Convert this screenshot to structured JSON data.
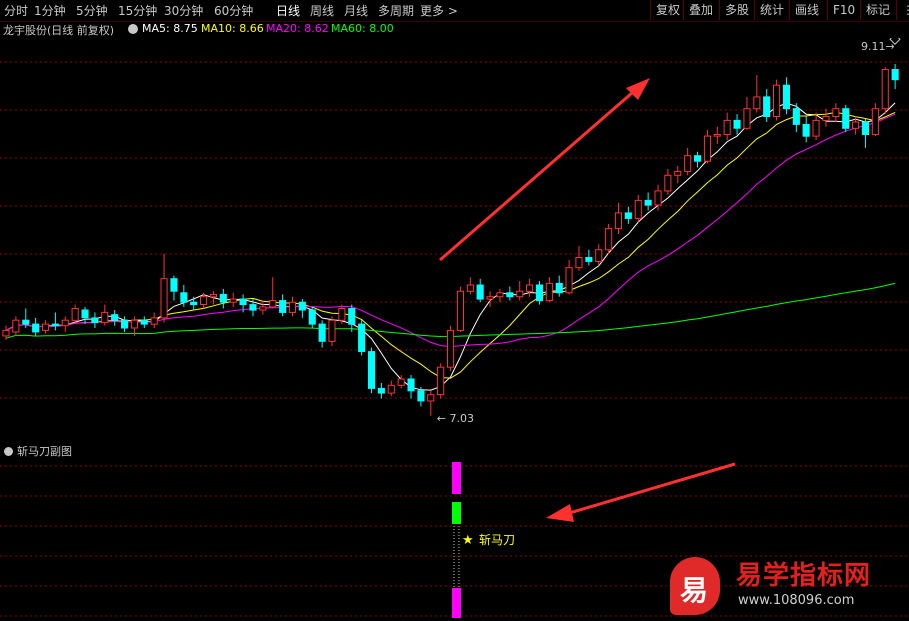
{
  "toolbar": {
    "tabs": [
      "分时",
      "1分钟",
      "5分钟",
      "15分钟",
      "30分钟",
      "60分钟",
      "日线",
      "周线",
      "月线",
      "多周期",
      "更多 >"
    ],
    "active_tab": "日线",
    "right_buttons": [
      "复权",
      "叠加",
      "多股",
      "统计",
      "画线",
      "F10",
      "标记"
    ],
    "more_icon": "ellipsis-icon"
  },
  "header": {
    "stock_title": "龙宇股份(日线 前复权)",
    "ma": [
      {
        "label": "MA5: 8.75",
        "color": "#ffffff"
      },
      {
        "label": "MA10: 8.66",
        "color": "#ffff00"
      },
      {
        "label": "MA20: 8.62",
        "color": "#ff00ff"
      },
      {
        "label": "MA60: 8.00",
        "color": "#00ff00"
      }
    ]
  },
  "main_chart": {
    "price_high_label": "9.11",
    "price_low_label": "7.03",
    "colors": {
      "up": "#ff3232",
      "down": "#00ffff",
      "ma5": "#ffffff",
      "ma10": "#ffff00",
      "ma20": "#ff00ff",
      "ma60": "#00ff00",
      "grid": "#8b0000",
      "arrow": "#ff3030"
    }
  },
  "sub_chart": {
    "title": "斩马刀副图",
    "signal_label": "斩马刀",
    "star": "★",
    "colors": {
      "pink": "#ff00ff",
      "green": "#00ff00",
      "label": "#ffff00"
    }
  },
  "watermark": {
    "logo_char": "易",
    "name": "易学指标网",
    "url": "www.108096.com"
  },
  "chart_data": {
    "type": "candlestick",
    "ohlc": [
      [
        8.05,
        8.12,
        8.18,
        8.0
      ],
      [
        8.1,
        8.25,
        8.3,
        8.05
      ],
      [
        8.25,
        8.2,
        8.4,
        8.15
      ],
      [
        8.2,
        8.1,
        8.28,
        8.05
      ],
      [
        8.12,
        8.2,
        8.25,
        8.08
      ],
      [
        8.2,
        8.18,
        8.35,
        8.12
      ],
      [
        8.18,
        8.25,
        8.3,
        8.1
      ],
      [
        8.25,
        8.4,
        8.45,
        8.2
      ],
      [
        8.38,
        8.28,
        8.42,
        8.2
      ],
      [
        8.28,
        8.22,
        8.35,
        8.15
      ],
      [
        8.22,
        8.35,
        8.45,
        8.18
      ],
      [
        8.32,
        8.25,
        8.38,
        8.18
      ],
      [
        8.25,
        8.15,
        8.3,
        8.1
      ],
      [
        8.15,
        8.25,
        8.3,
        8.05
      ],
      [
        8.25,
        8.2,
        8.3,
        8.15
      ],
      [
        8.2,
        8.28,
        8.35,
        8.15
      ],
      [
        8.28,
        8.78,
        9.1,
        8.22
      ],
      [
        8.78,
        8.62,
        8.82,
        8.5
      ],
      [
        8.6,
        8.48,
        8.7,
        8.42
      ],
      [
        8.48,
        8.45,
        8.55,
        8.38
      ],
      [
        8.45,
        8.55,
        8.6,
        8.4
      ],
      [
        8.55,
        8.58,
        8.62,
        8.45
      ],
      [
        8.58,
        8.48,
        8.65,
        8.4
      ],
      [
        8.48,
        8.52,
        8.6,
        8.42
      ],
      [
        8.52,
        8.45,
        8.58,
        8.35
      ],
      [
        8.45,
        8.38,
        8.52,
        8.3
      ],
      [
        8.38,
        8.42,
        8.5,
        8.32
      ],
      [
        8.42,
        8.5,
        8.8,
        8.4
      ],
      [
        8.5,
        8.35,
        8.58,
        8.3
      ],
      [
        8.35,
        8.48,
        8.55,
        8.3
      ],
      [
        8.48,
        8.38,
        8.52,
        8.28
      ],
      [
        8.38,
        8.2,
        8.42,
        8.15
      ],
      [
        8.2,
        7.98,
        8.25,
        7.9
      ],
      [
        7.98,
        8.25,
        8.3,
        7.92
      ],
      [
        8.25,
        8.4,
        8.45,
        8.2
      ],
      [
        8.4,
        8.2,
        8.45,
        8.1
      ],
      [
        8.2,
        7.85,
        8.25,
        7.8
      ],
      [
        7.85,
        7.38,
        7.9,
        7.32
      ],
      [
        7.38,
        7.32,
        7.45,
        7.25
      ],
      [
        7.32,
        7.42,
        7.48,
        7.28
      ],
      [
        7.42,
        7.5,
        7.55,
        7.38
      ],
      [
        7.5,
        7.35,
        7.55,
        7.25
      ],
      [
        7.35,
        7.22,
        7.4,
        7.15
      ],
      [
        7.22,
        7.3,
        7.35,
        7.03
      ],
      [
        7.3,
        7.65,
        7.7,
        7.25
      ],
      [
        7.65,
        8.12,
        8.18,
        7.6
      ],
      [
        8.12,
        8.62,
        8.68,
        8.1
      ],
      [
        8.62,
        8.7,
        8.8,
        8.58
      ],
      [
        8.7,
        8.52,
        8.78,
        8.48
      ],
      [
        8.52,
        8.55,
        8.62,
        8.42
      ],
      [
        8.55,
        8.6,
        8.65,
        8.48
      ],
      [
        8.6,
        8.55,
        8.68,
        8.5
      ],
      [
        8.55,
        8.62,
        8.75,
        8.5
      ],
      [
        8.62,
        8.7,
        8.78,
        8.55
      ],
      [
        8.7,
        8.5,
        8.75,
        8.45
      ],
      [
        8.5,
        8.72,
        8.8,
        8.48
      ],
      [
        8.72,
        8.6,
        8.82,
        8.55
      ],
      [
        8.6,
        8.92,
        9.02,
        8.58
      ],
      [
        8.92,
        9.05,
        9.2,
        8.88
      ],
      [
        9.05,
        9.0,
        9.15,
        8.95
      ],
      [
        9.0,
        9.15,
        9.22,
        8.95
      ],
      [
        9.15,
        9.42,
        9.48,
        9.1
      ],
      [
        9.42,
        9.62,
        9.75,
        9.35
      ],
      [
        9.62,
        9.55,
        9.7,
        9.48
      ],
      [
        9.55,
        9.78,
        9.85,
        9.5
      ],
      [
        9.78,
        9.72,
        9.88,
        9.65
      ],
      [
        9.72,
        9.9,
        9.98,
        9.65
      ],
      [
        9.9,
        10.1,
        10.18,
        9.85
      ],
      [
        10.1,
        10.15,
        10.22,
        10.0
      ],
      [
        10.15,
        10.35,
        10.45,
        10.1
      ],
      [
        10.35,
        10.28,
        10.4,
        10.2
      ],
      [
        10.28,
        10.6,
        10.68,
        10.25
      ],
      [
        10.6,
        10.62,
        10.72,
        10.5
      ],
      [
        10.62,
        10.8,
        10.9,
        10.55
      ],
      [
        10.8,
        10.7,
        10.88,
        10.62
      ],
      [
        10.7,
        10.95,
        11.1,
        10.68
      ],
      [
        10.95,
        11.1,
        11.38,
        10.9
      ],
      [
        11.1,
        10.85,
        11.2,
        10.78
      ],
      [
        10.85,
        11.25,
        11.32,
        10.8
      ],
      [
        11.25,
        10.95,
        11.35,
        10.88
      ],
      [
        10.95,
        10.75,
        11.02,
        10.65
      ],
      [
        10.75,
        10.6,
        10.85,
        10.52
      ],
      [
        10.6,
        10.8,
        10.9,
        10.55
      ],
      [
        10.8,
        10.85,
        10.95,
        10.72
      ],
      [
        10.85,
        10.95,
        11.02,
        10.78
      ],
      [
        10.95,
        10.7,
        11.0,
        10.65
      ],
      [
        10.7,
        10.78,
        10.85,
        10.62
      ],
      [
        10.78,
        10.62,
        10.82,
        10.45
      ],
      [
        10.62,
        10.95,
        11.02,
        10.6
      ],
      [
        10.95,
        11.45,
        11.48,
        10.88
      ],
      [
        11.45,
        11.32,
        11.52,
        11.2
      ]
    ],
    "price_high": 9.11,
    "price_low": 7.03,
    "ma_series": [
      {
        "name": "MA5",
        "last": 8.75
      },
      {
        "name": "MA10",
        "last": 8.66
      },
      {
        "name": "MA20",
        "last": 8.62
      },
      {
        "name": "MA60",
        "last": 8.0
      }
    ]
  }
}
